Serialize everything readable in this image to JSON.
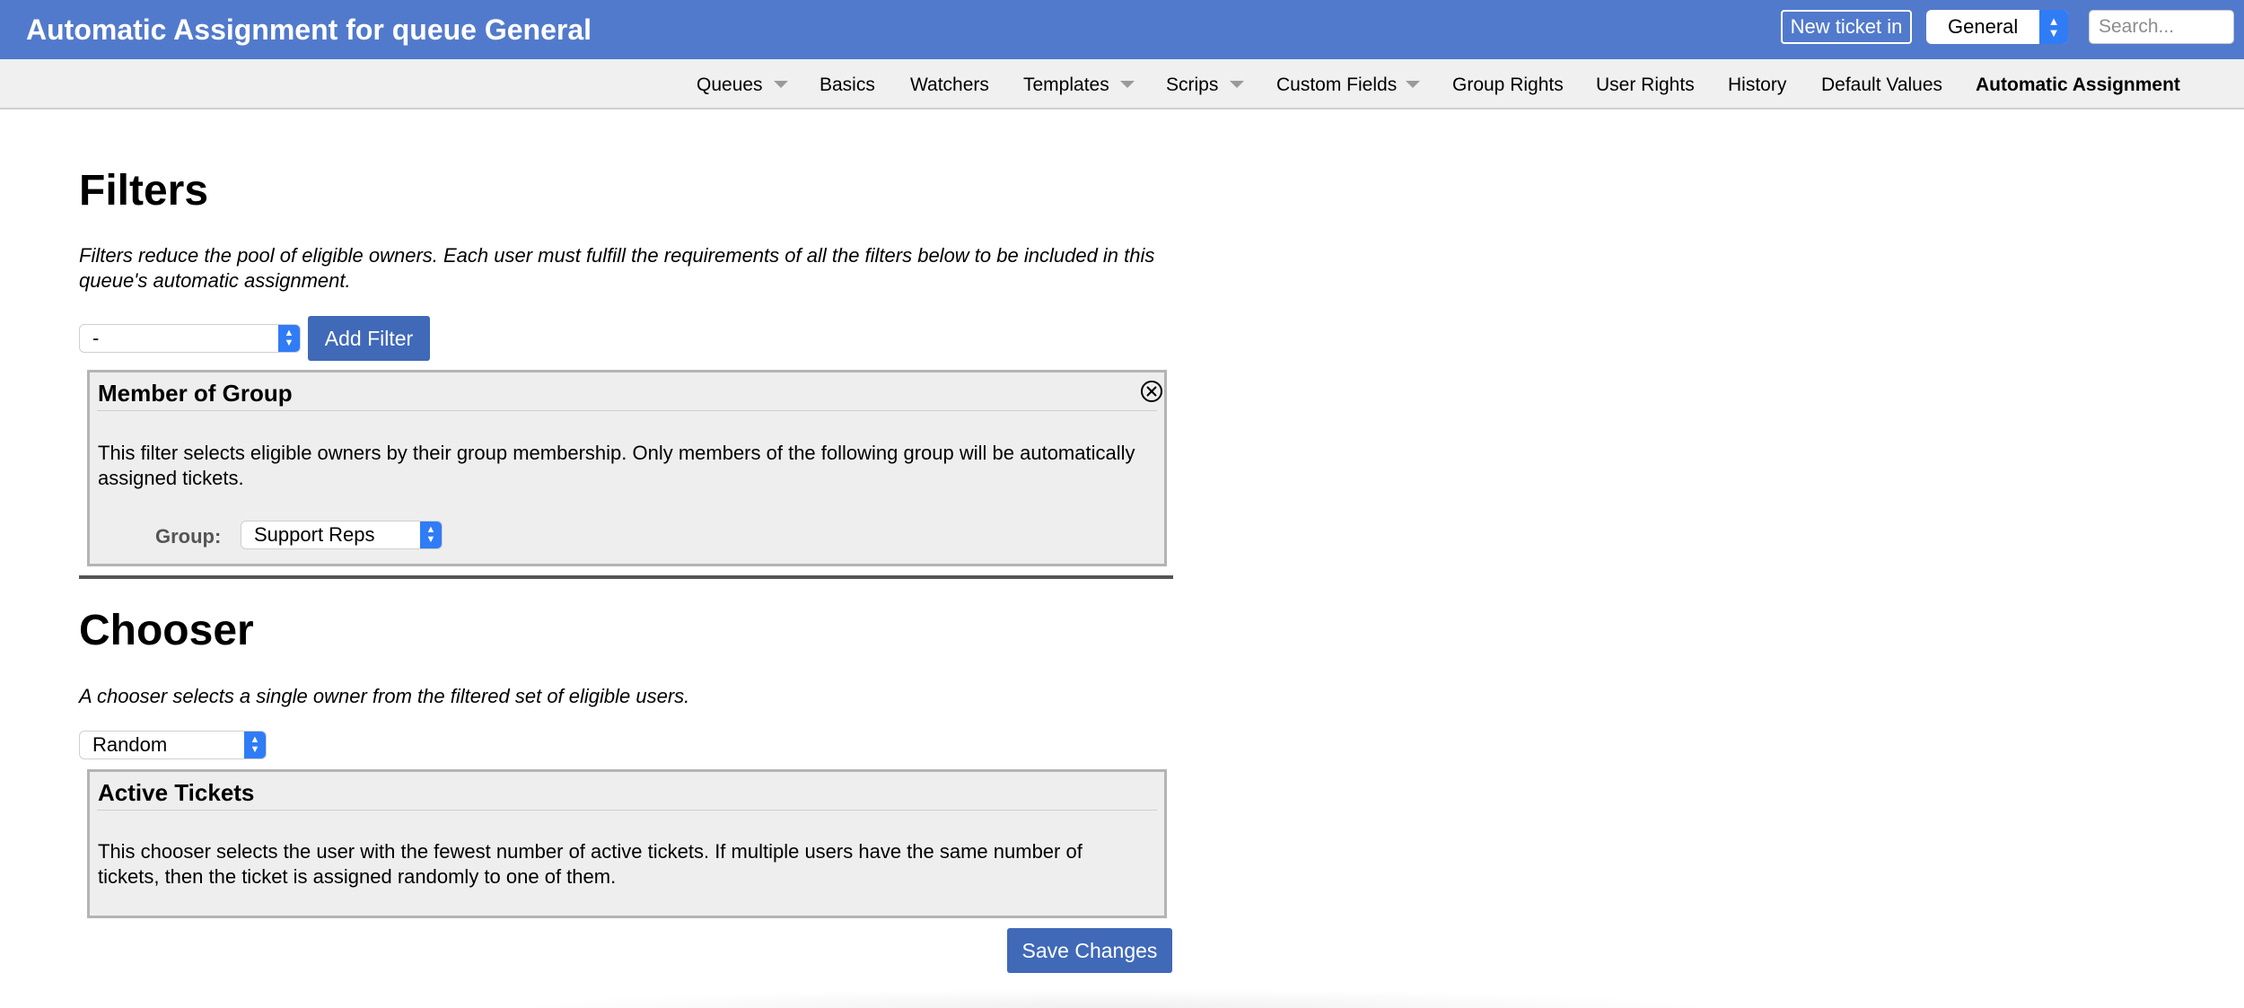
{
  "header": {
    "title": "Automatic Assignment for queue General",
    "new_ticket_label": "New ticket in",
    "queue_selected": "General",
    "search_placeholder": "Search..."
  },
  "nav": {
    "items": [
      {
        "label": "Queues",
        "has_menu": true
      },
      {
        "label": "Basics",
        "has_menu": false
      },
      {
        "label": "Watchers",
        "has_menu": false
      },
      {
        "label": "Templates",
        "has_menu": true
      },
      {
        "label": "Scrips",
        "has_menu": true
      },
      {
        "label": "Custom Fields",
        "has_menu": true
      },
      {
        "label": "Group Rights",
        "has_menu": false
      },
      {
        "label": "User Rights",
        "has_menu": false
      },
      {
        "label": "History",
        "has_menu": false
      },
      {
        "label": "Default Values",
        "has_menu": false
      },
      {
        "label": "Automatic Assignment",
        "has_menu": false,
        "active": true
      }
    ]
  },
  "filters": {
    "heading": "Filters",
    "description": "Filters reduce the pool of eligible owners. Each user must fulfill the requirements of all the filters below to be included in this queue's automatic assignment.",
    "select_value": "-",
    "add_button": "Add Filter",
    "panel": {
      "title": "Member of Group",
      "text": "This filter selects eligible owners by their group membership. Only members of the following group will be automatically assigned tickets.",
      "group_label": "Group:",
      "group_value": "Support Reps"
    }
  },
  "chooser": {
    "heading": "Chooser",
    "description": "A chooser selects a single owner from the filtered set of eligible users.",
    "select_value": "Random",
    "panel": {
      "title": "Active Tickets",
      "text": "This chooser selects the user with the fewest number of active tickets. If multiple users have the same number of tickets, then the ticket is assigned randomly to one of them."
    }
  },
  "save_button": "Save Changes",
  "colors": {
    "header_bg": "#527acc",
    "button_bg": "#4069b8",
    "select_accent": "#2f7cf6",
    "panel_bg": "#eeeeee"
  }
}
